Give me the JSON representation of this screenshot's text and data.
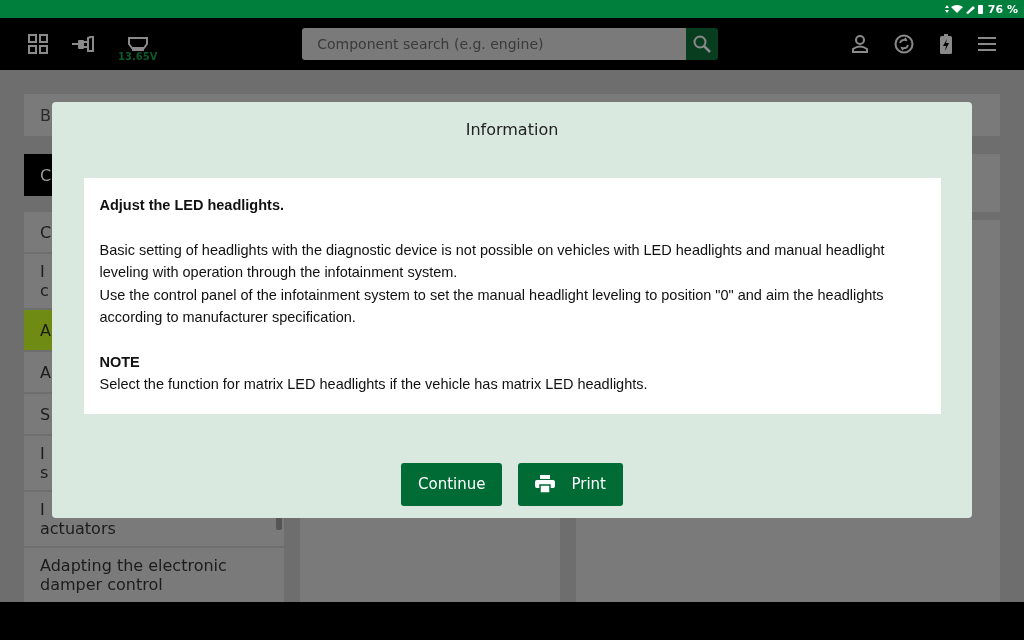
{
  "status_bar": {
    "battery": "76 %"
  },
  "toolbar": {
    "voltage": "13.65V",
    "search": {
      "placeholder": "Component search (e.g. engine)"
    }
  },
  "breadcrumb": "B",
  "sidebar": {
    "header": "C",
    "items": [
      {
        "lines": [
          "C"
        ],
        "selected": false
      },
      {
        "lines": [
          "I",
          "c"
        ],
        "selected": false
      },
      {
        "lines": [
          "A"
        ],
        "selected": true
      },
      {
        "lines": [
          "A"
        ],
        "selected": false
      },
      {
        "lines": [
          "S"
        ],
        "selected": false
      },
      {
        "lines": [
          "I",
          "s"
        ],
        "selected": false
      },
      {
        "lines": [
          "I",
          "actuators"
        ],
        "selected": false
      },
      {
        "lines": [
          "Adapting the electronic",
          "damper control"
        ],
        "selected": false
      }
    ]
  },
  "dialog": {
    "title": "Information",
    "heading": "Adjust the LED headlights.",
    "paragraphs": [
      "Basic setting of headlights with the diagnostic device is not possible on vehicles with LED headlights and manual headlight leveling with operation through the infotainment system.",
      "Use the control panel of the infotainment system to set the manual headlight leveling to position \"0\" and aim the headlights according to manufacturer specification."
    ],
    "note_label": "NOTE",
    "note": "Select the function for matrix LED headlights if the vehicle has matrix LED headlights.",
    "buttons": [
      {
        "label": "Continue",
        "kind": "plain"
      },
      {
        "label": "Print",
        "kind": "print"
      }
    ]
  }
}
